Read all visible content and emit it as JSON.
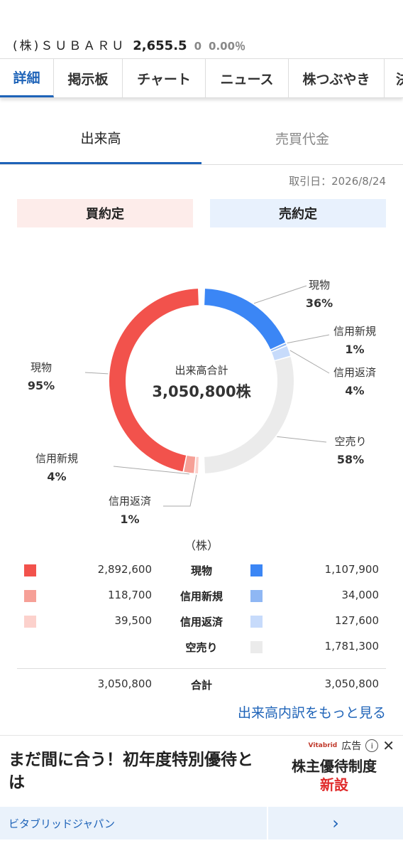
{
  "ticker": {
    "name": "(株)ＳＵＢＡＲＵ",
    "price": "2,655.5",
    "change": "0",
    "change_pct": "0.00％"
  },
  "tabs": [
    "詳細",
    "掲示板",
    "チャート",
    "ニュース",
    "株つぶやき",
    "決"
  ],
  "subtabs": [
    "出来高",
    "売買代金"
  ],
  "date_label": "取引日：2026/8/24",
  "buttons": {
    "buy": "買約定",
    "sell": "売約定"
  },
  "center": {
    "label": "出来高合計",
    "value": "3,050,800株"
  },
  "colors": {
    "buy_spot": "#f2524c",
    "buy_margin_new": "#f6a097",
    "buy_margin_repay": "#fcd1cc",
    "sell_spot": "#3b86f5",
    "sell_margin_new": "#8fb7f4",
    "sell_margin_repay": "#c7dbfb",
    "short": "#ebebeb"
  },
  "chart_data": {
    "type": "pie",
    "buy": [
      {
        "label": "現物",
        "pct": "95%",
        "share": 95
      },
      {
        "label": "信用新規",
        "pct": "4%",
        "share": 4
      },
      {
        "label": "信用返済",
        "pct": "1%",
        "share": 1
      }
    ],
    "sell": [
      {
        "label": "現物",
        "pct": "36%",
        "share": 36
      },
      {
        "label": "信用新規",
        "pct": "1%",
        "share": 1
      },
      {
        "label": "信用返済",
        "pct": "4%",
        "share": 4
      },
      {
        "label": "空売り",
        "pct": "58%",
        "share": 58
      }
    ]
  },
  "legend": {
    "unit": "（株）",
    "rows": [
      {
        "label": "現物",
        "buy": "2,892,600",
        "sell": "1,107,900"
      },
      {
        "label": "信用新規",
        "buy": "118,700",
        "sell": "34,000"
      },
      {
        "label": "信用返済",
        "buy": "39,500",
        "sell": "127,600"
      },
      {
        "label": "空売り",
        "buy": "",
        "sell": "1,781,300"
      }
    ],
    "total": {
      "label": "合計",
      "buy": "3,050,800",
      "sell": "3,050,800"
    }
  },
  "more_link": "出来高内訳をもっと見る",
  "ad": {
    "headline": "まだ間に合う！初年度特別優待とは",
    "tag": "広告",
    "brand": "Vitabrid",
    "side_line1": "株主優待制度",
    "side_line2": "新設",
    "advertiser": "ビタブリッドジャパン",
    "arrow": "›"
  }
}
